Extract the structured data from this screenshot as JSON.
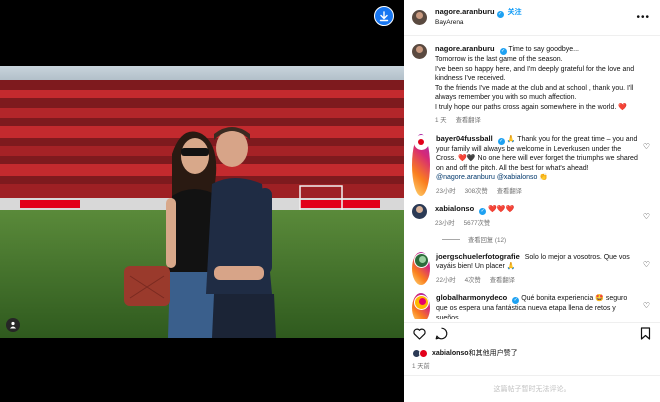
{
  "post": {
    "author": "nagore.aranburu",
    "follow_label": "关注",
    "location": "BayArena",
    "caption_lines": [
      "Time to say goodbye...",
      "Tomorrow is the last game of the season.",
      "I've been so happy here, and I'm deeply grateful for the love and kindness I've received.",
      "To the friends I've made at the club and at school , thank you. I'll always remember you with so much affection.",
      "I truly hope our paths cross again somewhere in the world. ❤️"
    ],
    "caption_time": "1 天",
    "caption_translate": "查看翻译"
  },
  "comments": [
    {
      "user": "bayer04fussball",
      "text_a": "🙏 Thank you for the great time – you and your family will always be welcome in Leverkusen under the Cross. ❤️🖤 No one here will ever forget the triumphs we shared on and off the pitch. All the best for what's ahead!",
      "mentions": "@nagore.aranburu @xabialonso",
      "emoji_tail": "👏",
      "time": "23小时",
      "likes": "308次赞",
      "translate": "查看翻译"
    },
    {
      "user": "xabialonso",
      "text_a": "❤️❤️❤️",
      "time": "23小时",
      "likes": "5677次赞",
      "replies": "查看回复 (12)"
    },
    {
      "user": "joergschuelerfotografie",
      "text_a": "Solo lo mejor a vosotros. Que vos vayáis bien! Un placer 🙏",
      "time": "22小时",
      "likes": "4次赞",
      "translate": "查看翻译"
    },
    {
      "user": "globalharmonydeco",
      "text_a": "Qué bonita experiencia 🤩 seguro que os espera una fantástica nueva etapa llena de retos y sueños"
    }
  ],
  "likes_line": {
    "user": "xabialonso",
    "suffix": "和其他用户赞了"
  },
  "post_date": "1 天前",
  "add_comment_placeholder": "这篇帖子暂时无法评论。",
  "icons": {
    "download": "download-icon",
    "tagged_users": "person-icon",
    "more": "more-icon",
    "like": "heart-icon",
    "comment": "comment-icon",
    "save": "bookmark-icon"
  },
  "colors": {
    "accent_blue": "#0095f6",
    "verified": "#1da1f2",
    "heart_red": "#e0245e"
  }
}
